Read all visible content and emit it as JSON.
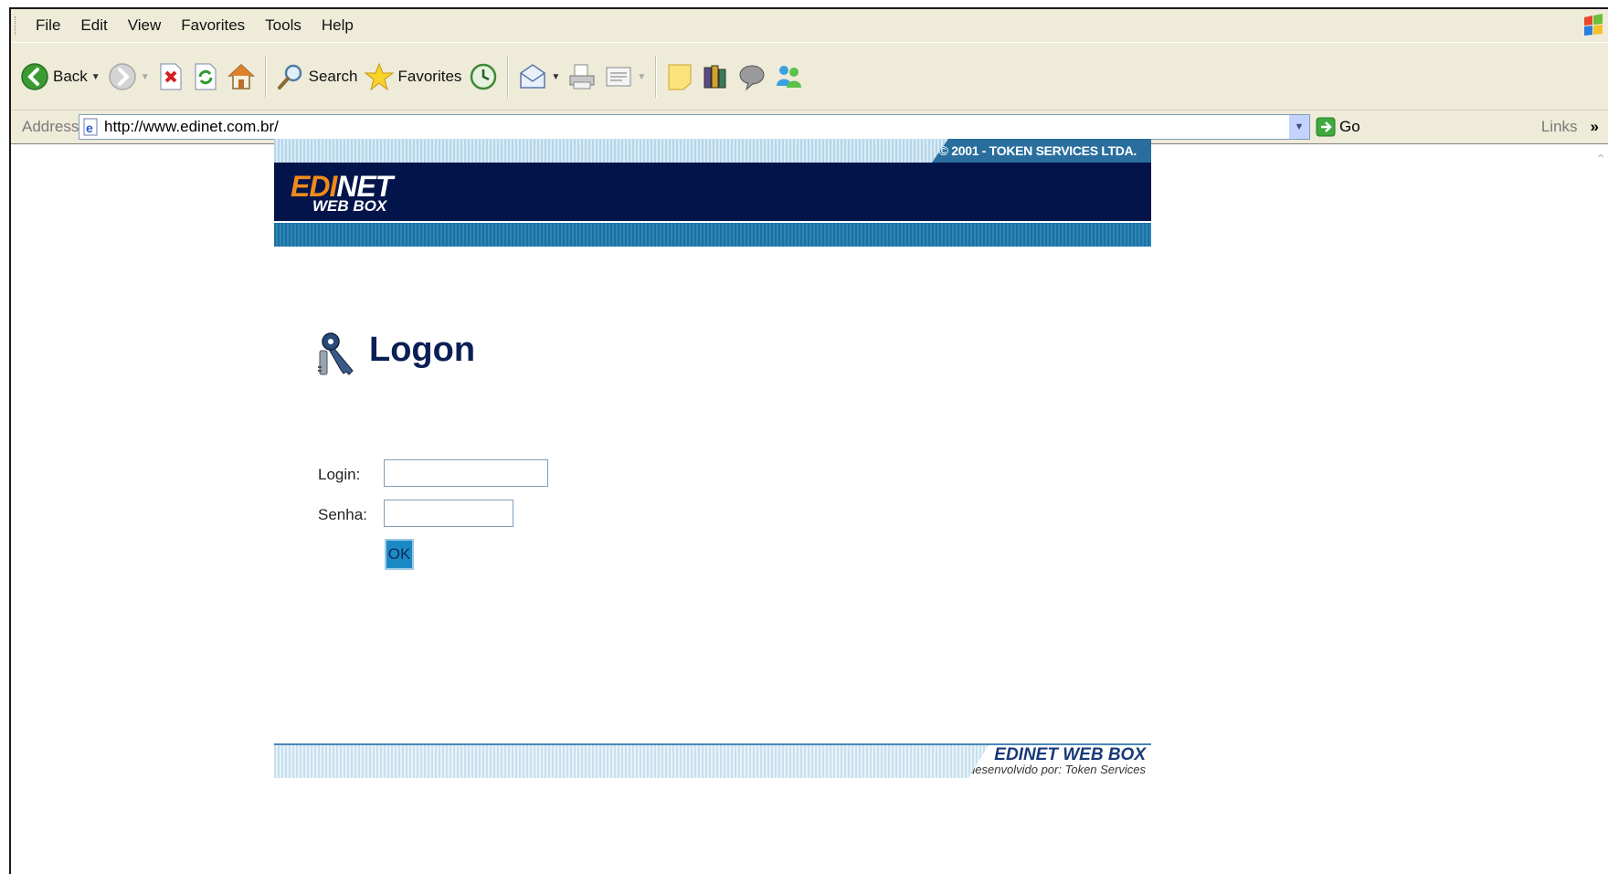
{
  "browser": {
    "menu": [
      "File",
      "Edit",
      "View",
      "Favorites",
      "Tools",
      "Help"
    ],
    "toolbar": {
      "back_label": "Back",
      "search_label": "Search",
      "favorites_label": "Favorites"
    },
    "address": {
      "label": "Address",
      "url": "http://www.edinet.com.br/",
      "go_label": "Go",
      "links_label": "Links",
      "links_chevron": "»"
    }
  },
  "page": {
    "header": {
      "copyright": "© 2001 - TOKEN SERVICES LTDA.",
      "logo_edi": "EDI",
      "logo_net": "NET",
      "logo_sub": "WEB BOX"
    },
    "logon": {
      "title": "Logon",
      "login_label": "Login:",
      "login_value": "",
      "senha_label": "Senha:",
      "senha_value": "",
      "ok_label": "OK"
    },
    "footer": {
      "title": "EDINET WEB BOX",
      "subtitle": "desenvolvido por: Token Services"
    }
  },
  "colors": {
    "chrome_bg": "#eeebd9",
    "header_navy": "#03144a",
    "logo_orange": "#f08a1c",
    "title_navy": "#0a1f55",
    "ok_blue": "#1b8ac4"
  }
}
